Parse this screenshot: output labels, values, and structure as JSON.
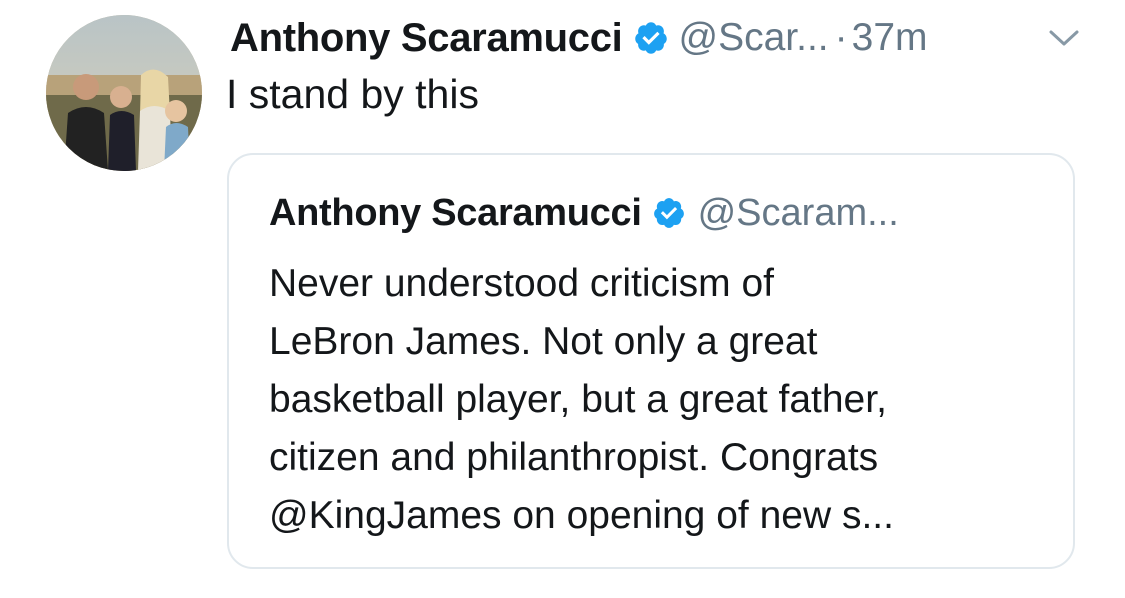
{
  "tweet": {
    "author_name": "Anthony Scaramucci",
    "handle": "@Scar...",
    "separator": "·",
    "time": "37m",
    "text": "I stand by this",
    "verified_icon": "verified-badge-icon",
    "caret_icon": "chevron-down-icon"
  },
  "quoted_tweet": {
    "author_name": "Anthony Scaramucci",
    "handle": "@Scaram...",
    "lines": [
      "Never understood criticism of",
      "LeBron James. Not only a great",
      "basketball player, but a great father,",
      "citizen and philanthropist. Congrats",
      "@KingJames on opening of new s..."
    ]
  },
  "colors": {
    "verified_blue": "#1da1f2",
    "secondary_text": "#657786",
    "border": "#e1e8ed"
  }
}
